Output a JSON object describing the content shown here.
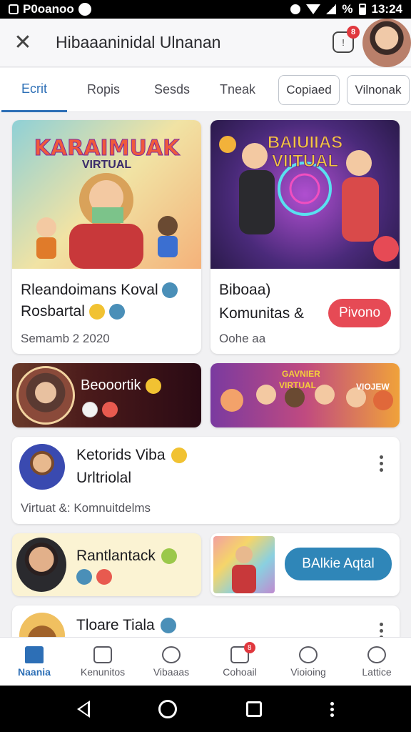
{
  "status_bar": {
    "carrier": "P0oanoo",
    "time": "13:24",
    "battery": "%"
  },
  "app_bar": {
    "title": "Hibaaaninidal Ulnanan",
    "notification_count": "8"
  },
  "tabs": [
    {
      "label": "Ecrit",
      "active": true
    },
    {
      "label": "Ropis"
    },
    {
      "label": "Sesds"
    },
    {
      "label": "Tneak"
    },
    {
      "label": "Copiaed"
    },
    {
      "label": "Vilnonak"
    }
  ],
  "cards": {
    "card1": {
      "image_caption": "KARAIMUAK",
      "image_sub": "VIRTUAL",
      "title_line1": "Rleandoimans Koval",
      "title_line2": "Rosbartal",
      "subtitle": "Semamb 2 2020"
    },
    "card2": {
      "image_caption": "BAIUIIAS",
      "image_sub": "VIITUAL",
      "title_line1": "Biboaa)",
      "title_line2": "Komunitas &",
      "subtitle": "Oohe aa",
      "action_label": "Pivono"
    },
    "card3": {
      "title": "Beooortik"
    },
    "card4": {
      "banner_top": "GAVNIER",
      "banner_mid": "VIRTUAL",
      "banner_right": "VIOJEW"
    },
    "card5": {
      "title_line1": "Ketorids Viba",
      "title_line2": "Urltriolal",
      "subtitle": "Virtuat &: Komnuitdelms"
    },
    "card6": {
      "title": "Rantlantack"
    },
    "card7": {
      "action_label": "BAlkie Aqtal"
    },
    "card8": {
      "title": "Tloare Tiala"
    }
  },
  "bottom_nav": [
    {
      "label": "Naania",
      "icon": "home-icon",
      "active": true
    },
    {
      "label": "Kenunitos",
      "icon": "community-icon"
    },
    {
      "label": "Vibaaas",
      "icon": "camera-icon"
    },
    {
      "label": "Cohoail",
      "icon": "mail-icon",
      "badge": "8"
    },
    {
      "label": "Vioioing",
      "icon": "chat-icon"
    },
    {
      "label": "Lattice",
      "icon": "profile-icon"
    }
  ],
  "colors": {
    "accent": "#2d6fb6",
    "badge": "#e0383e",
    "pill_red": "#e64a55",
    "pill_blue": "#2f86b8"
  }
}
